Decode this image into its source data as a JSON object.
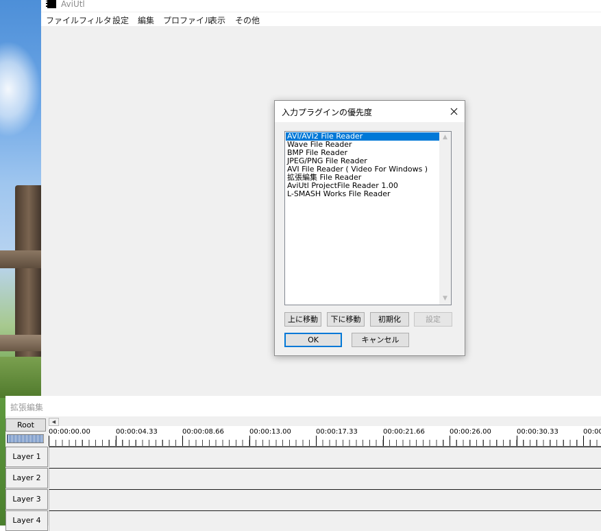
{
  "app": {
    "title": "AviUtl"
  },
  "menu": [
    "ファイル",
    "フィルタ",
    "設定",
    "編集",
    "プロファイル",
    "表示",
    "その他"
  ],
  "dialog": {
    "title": "入力プラグインの優先度",
    "items": [
      "AVI/AVI2 File Reader",
      "Wave File Reader",
      "BMP File Reader",
      "JPEG/PNG File Reader",
      "AVI File Reader ( Video For Windows )",
      "拡張編集 File Reader",
      "AviUtl ProjectFile Reader 1.00",
      "L-SMASH Works File Reader"
    ],
    "selected_index": 0,
    "buttons": {
      "move_up": "上に移動",
      "move_down": "下に移動",
      "reset": "初期化",
      "settings": "設定",
      "ok": "OK",
      "cancel": "キャンセル"
    }
  },
  "timeline": {
    "title": "拡張編集",
    "root_label": "Root",
    "ruler": [
      "00:00:00.00",
      "00:00:04.33",
      "00:00:08.66",
      "00:00:13.00",
      "00:00:17.33",
      "00:00:21.66",
      "00:00:26.00",
      "00:00:30.33",
      "00:00"
    ],
    "layers": [
      "Layer 1",
      "Layer 2",
      "Layer 3",
      "Layer 4"
    ]
  },
  "colors": {
    "selection": "#0078d7",
    "window_bg": "#f0f0f0"
  }
}
